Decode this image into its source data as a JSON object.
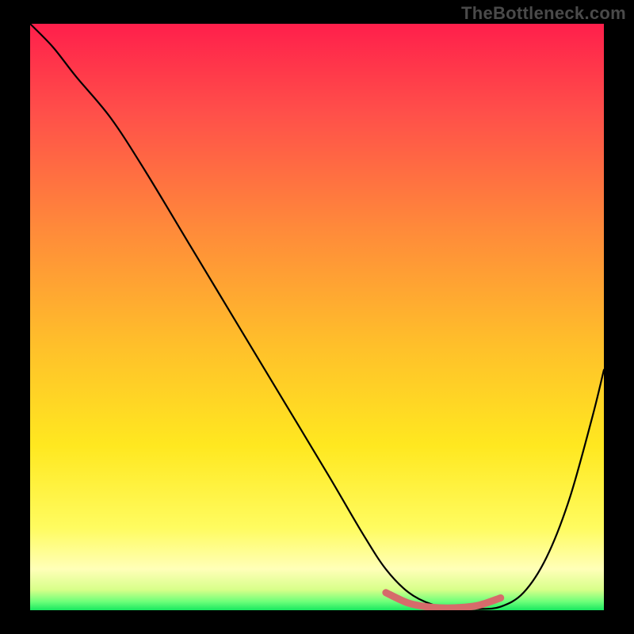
{
  "watermark": "TheBottleneck.com",
  "chart_data": {
    "type": "line",
    "title": "",
    "xlabel": "",
    "ylabel": "",
    "xlim": [
      0,
      100
    ],
    "ylim": [
      0,
      100
    ],
    "grid": false,
    "series": [
      {
        "name": "curve",
        "x": [
          0,
          4,
          8,
          14,
          20,
          28,
          36,
          44,
          52,
          58,
          62,
          66,
          70,
          74,
          78,
          82,
          86,
          90,
          94,
          98,
          100
        ],
        "y": [
          100,
          96,
          91,
          84,
          75,
          62,
          49,
          36,
          23,
          13,
          7,
          3,
          1,
          0.3,
          0.2,
          0.6,
          3,
          9,
          19,
          33,
          41
        ]
      }
    ],
    "highlight_segment": {
      "name": "bottom-marker",
      "color": "#d66b6b",
      "x": [
        62,
        66,
        70,
        74,
        78,
        82
      ],
      "y": [
        3,
        1.2,
        0.5,
        0.4,
        0.8,
        2.1
      ]
    },
    "gradient_stops": [
      {
        "offset": 0.0,
        "color": "#ff1f4b"
      },
      {
        "offset": 0.15,
        "color": "#ff4f4a"
      },
      {
        "offset": 0.35,
        "color": "#ff8a3a"
      },
      {
        "offset": 0.55,
        "color": "#ffc02a"
      },
      {
        "offset": 0.72,
        "color": "#ffe820"
      },
      {
        "offset": 0.86,
        "color": "#fffc60"
      },
      {
        "offset": 0.93,
        "color": "#ffffb8"
      },
      {
        "offset": 0.965,
        "color": "#d8ff8a"
      },
      {
        "offset": 0.985,
        "color": "#6fff7a"
      },
      {
        "offset": 1.0,
        "color": "#18e860"
      }
    ]
  }
}
